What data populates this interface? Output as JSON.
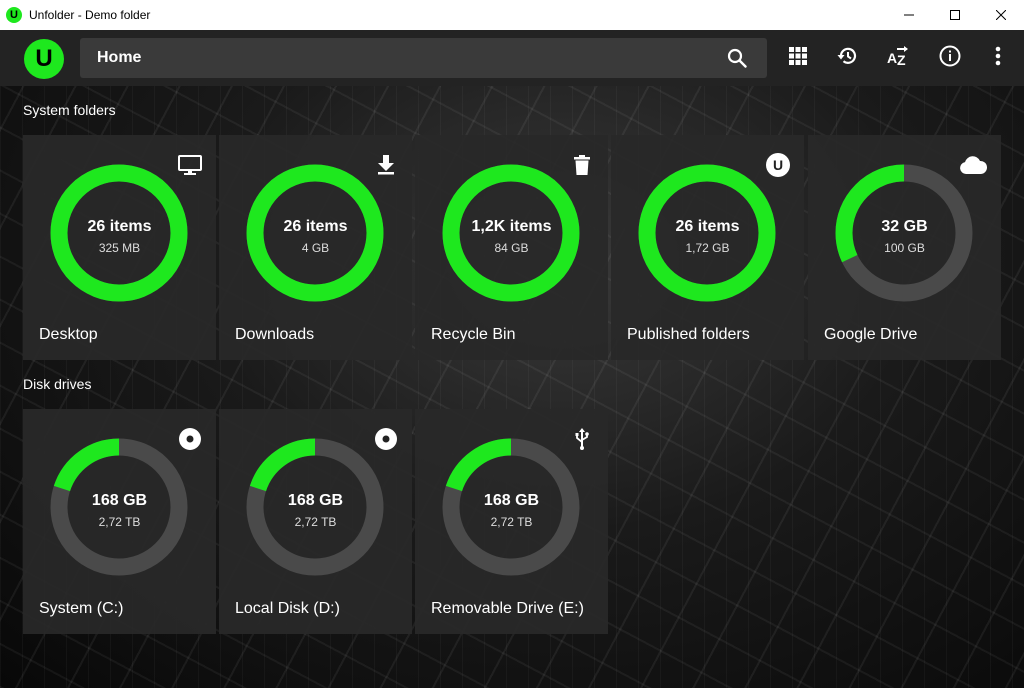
{
  "window": {
    "title": "Unfolder - Demo folder",
    "app_icon_letter": "U"
  },
  "appbar": {
    "logo_letter": "U",
    "location": "Home"
  },
  "colors": {
    "accent": "#1ee81e",
    "track": "#4a4a4a",
    "tile_bg": "#282828",
    "appbar_bg": "#232323"
  },
  "sections": {
    "system": "System folders",
    "disks": "Disk drives"
  },
  "system_folders": [
    {
      "name": "Desktop",
      "main": "26 items",
      "sub": "325 MB",
      "fill": 1.0,
      "icon": "monitor-icon"
    },
    {
      "name": "Downloads",
      "main": "26 items",
      "sub": "4 GB",
      "fill": 1.0,
      "icon": "download-icon"
    },
    {
      "name": "Recycle Bin",
      "main": "1,2K items",
      "sub": "84 GB",
      "fill": 1.0,
      "icon": "trash-icon"
    },
    {
      "name": "Published folders",
      "main": "26 items",
      "sub": "1,72 GB",
      "fill": 1.0,
      "icon": "unfolder-logo-icon",
      "icon_text": "U"
    },
    {
      "name": "Google Drive",
      "main": "32 GB",
      "sub": "100 GB",
      "fill": 0.32,
      "icon": "cloud-icon"
    }
  ],
  "disk_drives": [
    {
      "name": "System (C:)",
      "main": "168 GB",
      "sub": "2,72 TB",
      "fill": 0.2,
      "icon": "disk-icon"
    },
    {
      "name": "Local Disk (D:)",
      "main": "168 GB",
      "sub": "2,72 TB",
      "fill": 0.2,
      "icon": "disk-icon"
    },
    {
      "name": "Removable Drive (E:)",
      "main": "168 GB",
      "sub": "2,72 TB",
      "fill": 0.2,
      "icon": "usb-icon"
    }
  ]
}
